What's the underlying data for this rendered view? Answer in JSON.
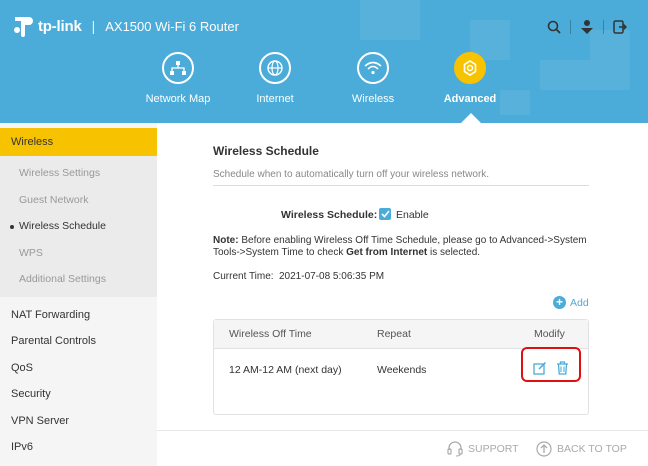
{
  "header": {
    "brand": "tp-link",
    "separator": "|",
    "model": "AX1500 Wi-Fi 6 Router",
    "bg_color": "#4bacd9",
    "top_icons": [
      "search-icon",
      "user-icon",
      "logout-icon"
    ]
  },
  "nav": {
    "items": [
      {
        "label": "Network Map",
        "icon": "network-map-icon",
        "active": false
      },
      {
        "label": "Internet",
        "icon": "globe-icon",
        "active": false
      },
      {
        "label": "Wireless",
        "icon": "wifi-icon",
        "active": false
      },
      {
        "label": "Advanced",
        "icon": "gear-icon",
        "active": true
      }
    ],
    "active_color": "#f7c300"
  },
  "sidebar": {
    "main_active": "Wireless",
    "sub_items": [
      {
        "label": "Wireless Settings",
        "active": false
      },
      {
        "label": "Guest Network",
        "active": false
      },
      {
        "label": "Wireless Schedule",
        "active": true
      },
      {
        "label": "WPS",
        "active": false
      },
      {
        "label": "Additional Settings",
        "active": false
      }
    ],
    "other_items": [
      "NAT Forwarding",
      "Parental Controls",
      "QoS",
      "Security",
      "VPN Server",
      "IPv6"
    ]
  },
  "main": {
    "title": "Wireless Schedule",
    "description": "Schedule when to automatically turn off your wireless network.",
    "schedule_label": "Wireless Schedule:",
    "schedule_enabled": true,
    "enable_label": "Enable",
    "note_prefix": "Note:",
    "note_text": " Before enabling Wireless Off Time Schedule, please go to Advanced->System Tools->System Time to check ",
    "note_bold": "Get from Internet",
    "note_suffix": " is selected.",
    "current_time_label": "Current Time:",
    "current_time_value": "2021-07-08 5:06:35 PM",
    "add_label": "Add",
    "table": {
      "headers": [
        "Wireless Off Time",
        "Repeat",
        "Modify"
      ],
      "rows": [
        {
          "off_time": "12 AM-12 AM (next day)",
          "repeat": "Weekends"
        }
      ]
    }
  },
  "footer": {
    "support": "SUPPORT",
    "back_to_top": "BACK TO TOP"
  },
  "colors": {
    "accent": "#4bacd9",
    "active": "#f7c300",
    "highlight": "#e01010"
  }
}
